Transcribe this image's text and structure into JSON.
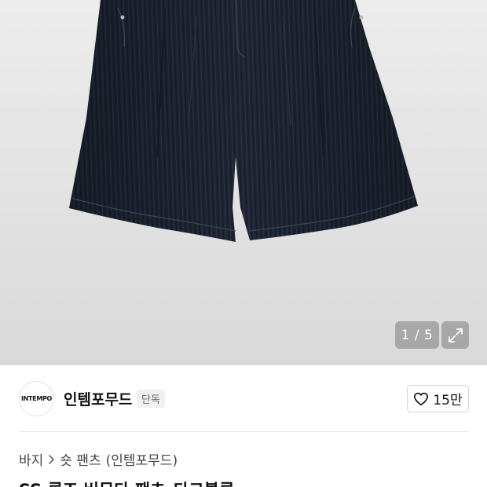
{
  "gallery": {
    "counter": "1 / 5",
    "expand_icon": "expand-arrows-icon",
    "image_alt": "denim shorts"
  },
  "brand": {
    "logo_text": "INTEMPO",
    "name": "인템포무드",
    "badge": "단독",
    "like_icon": "heart-outline-icon",
    "like_count": "15만"
  },
  "breadcrumb": {
    "category": "바지",
    "separator_icon": "chevron-right-icon",
    "subcategory": "숏 팬츠",
    "brand_suffix": "(인템포무드)"
  },
  "product": {
    "title": "SS 루즈 버뮤다 팬츠_다크블루"
  }
}
